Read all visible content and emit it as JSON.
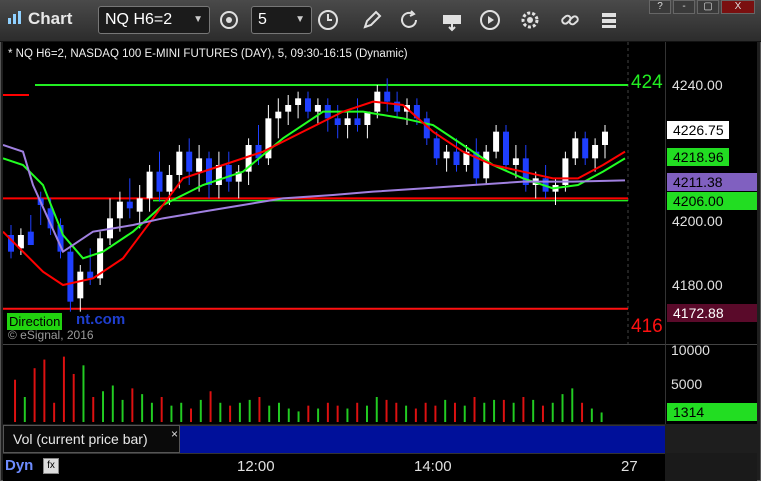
{
  "window": {
    "title": "Chart",
    "symbol": "NQ H6=2",
    "interval": "5",
    "buttons": {
      "minimize": "-",
      "restore": "▢",
      "close": "X",
      "help": "?"
    }
  },
  "toolbar_icons": [
    "clock-refresh-icon",
    "timer-icon",
    "pencil-icon",
    "cursor-icon",
    "settings-icon",
    "play-icon",
    "link-icon",
    "stack-icon"
  ],
  "chart": {
    "header": "* NQ H6=2, NASDAQ 100 E-MINI FUTURES (DAY), 5, 09:30-16:15 (Dynamic)",
    "copyright": "© eSignal, 2016",
    "watermark_left": "Direction",
    "watermark_right": "nt.com",
    "dyn_label": "Dyn",
    "volume_study_label": "Vol (current price bar)",
    "volume_close": "×",
    "colors": {
      "bullish": "#ffffff",
      "bearish": "#1f3fff",
      "ma_red": "#ff0000",
      "ma_green": "#22ff22",
      "ma_purple": "#a080e0",
      "line_green": "#22ee22",
      "line_red": "#ff1111"
    }
  },
  "chart_data": {
    "type": "candlestick",
    "price_axis": {
      "ticks": [
        "4240.00",
        "4200.00",
        "4180.00"
      ],
      "ylim": [
        4168,
        4249
      ]
    },
    "price_tags": [
      {
        "value": "4226.75",
        "bg": "#ffffff",
        "fg": "#000000"
      },
      {
        "value": "4218.96",
        "bg": "#22dd22",
        "fg": "#000000"
      },
      {
        "value": "4211.38",
        "bg": "#8060c0",
        "fg": "#000000"
      },
      {
        "value": "4206.00",
        "bg": "#22dd22",
        "fg": "#000000"
      },
      {
        "value": "4172.88",
        "bg": "#5a0a2a",
        "fg": "#ffffff"
      }
    ],
    "horizontal_lines": [
      {
        "value": 4240.0,
        "color": "#22ee22",
        "label": "424"
      },
      {
        "value": 4172.88,
        "color": "#ff1111",
        "label": "416"
      }
    ],
    "time_axis": {
      "ticks": [
        "12:00",
        "14:00",
        "27"
      ]
    },
    "volume_axis": {
      "ticks": [
        "10000",
        "5000"
      ],
      "current": "1314"
    },
    "volume": {
      "ylim": [
        0,
        12000
      ]
    }
  }
}
